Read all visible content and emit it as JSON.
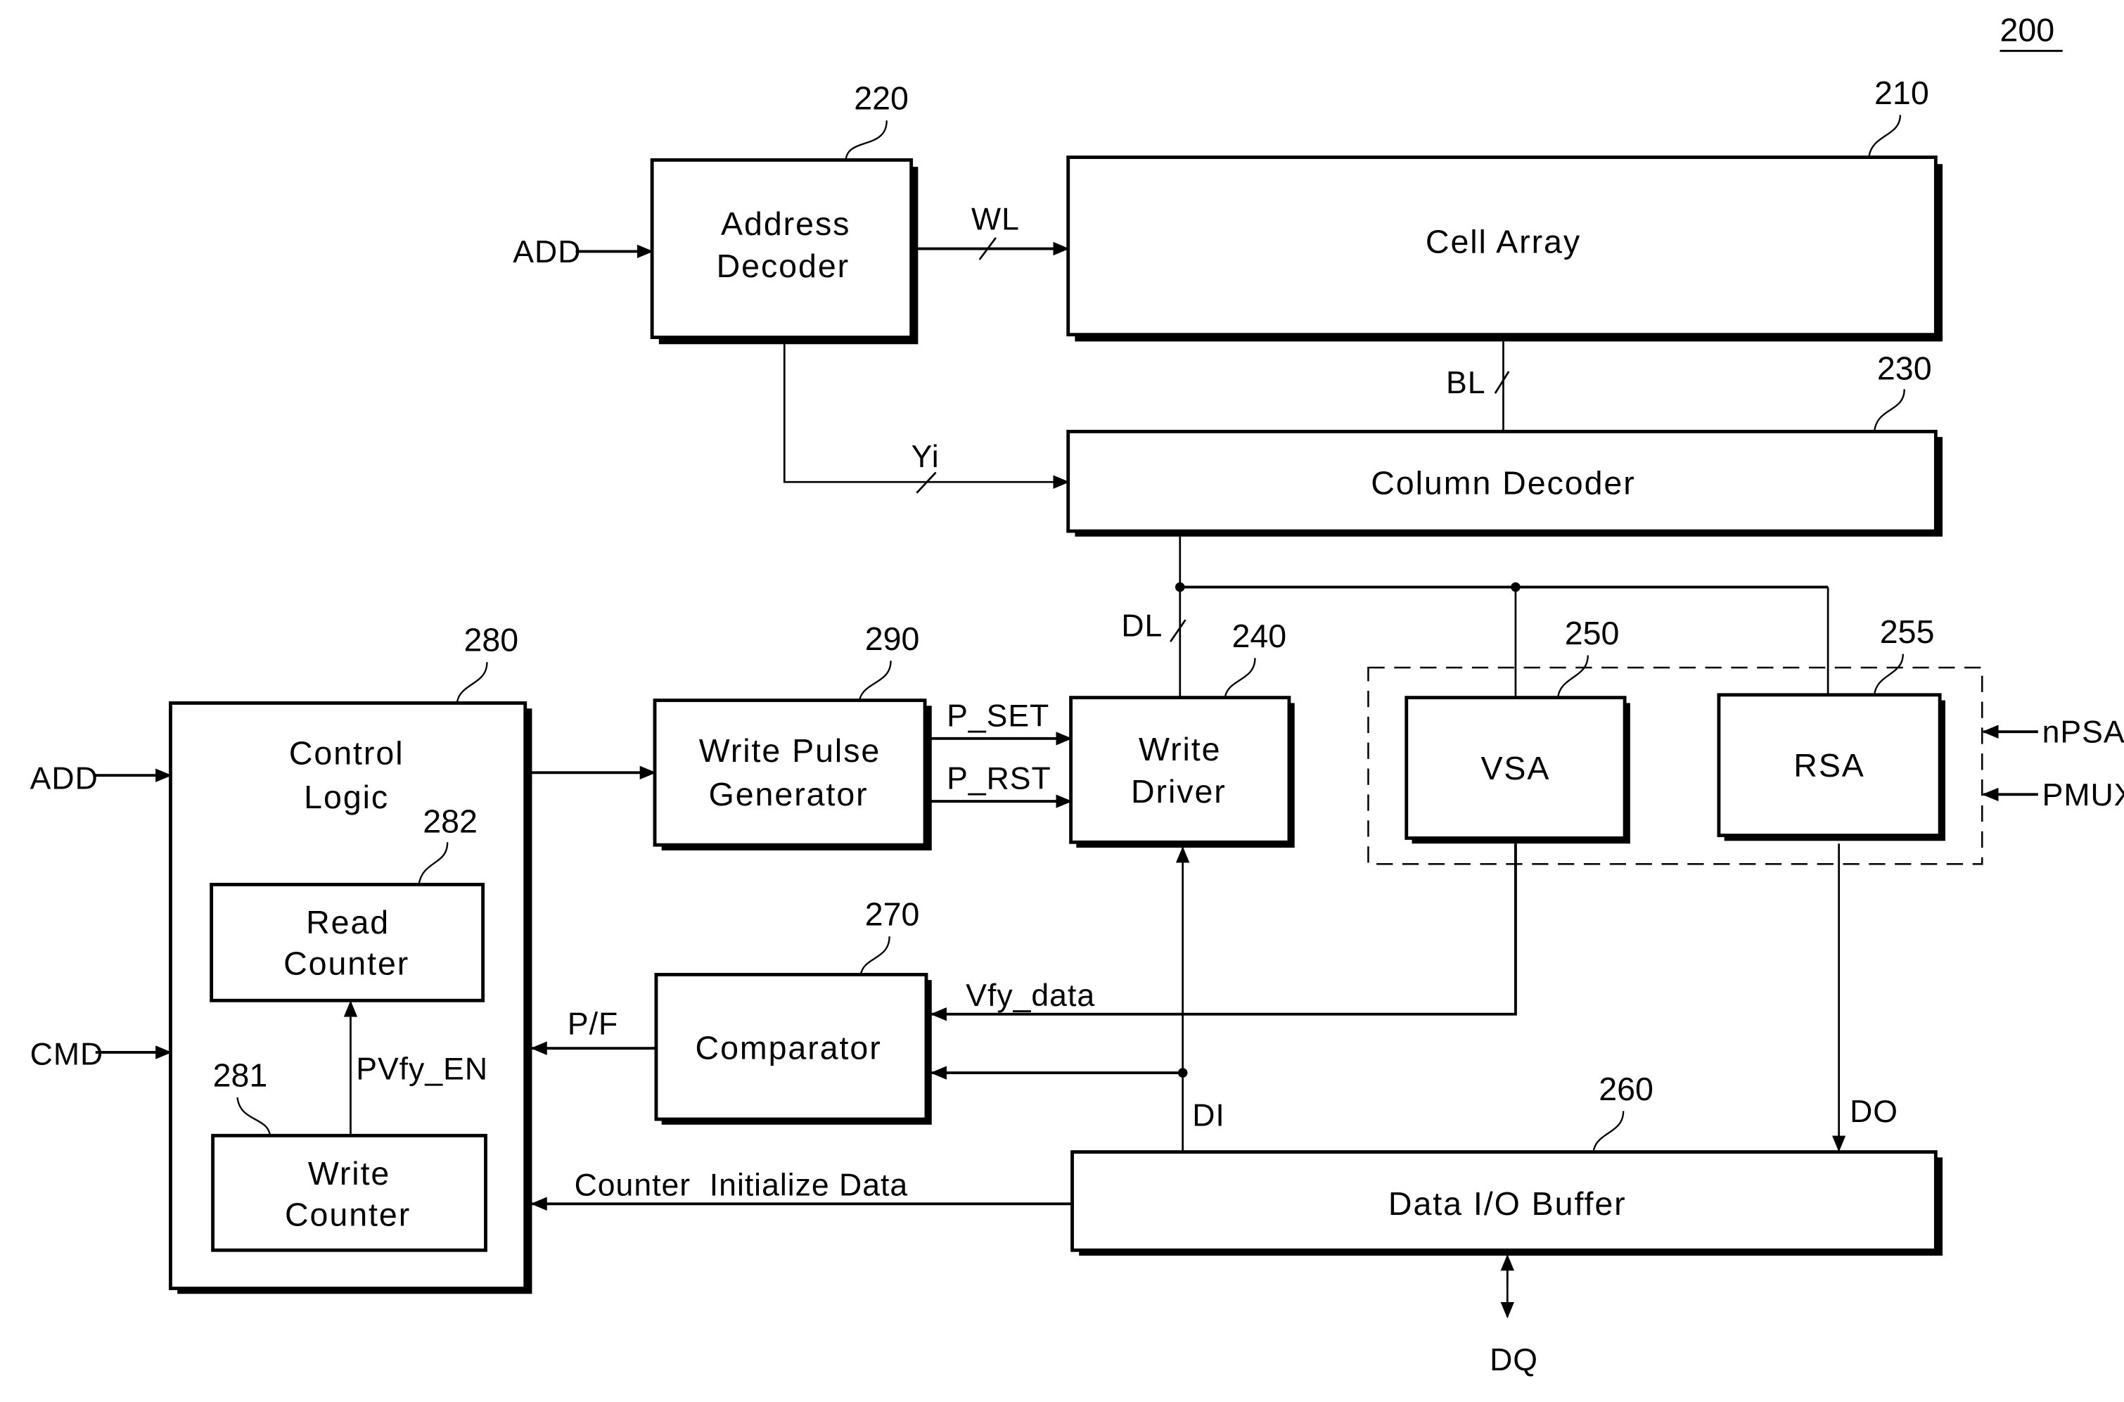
{
  "figure": {
    "ref": "200",
    "blocks": {
      "cell_array": {
        "ref": "210",
        "label": [
          "Cell Array"
        ]
      },
      "address_decoder": {
        "ref": "220",
        "label": [
          "Address",
          "Decoder"
        ]
      },
      "column_decoder": {
        "ref": "230",
        "label": [
          "Column Decoder"
        ]
      },
      "write_driver": {
        "ref": "240",
        "label": [
          "Write",
          "Driver"
        ]
      },
      "vsa": {
        "ref": "250",
        "label": [
          "VSA"
        ]
      },
      "rsa": {
        "ref": "255",
        "label": [
          "RSA"
        ]
      },
      "data_io_buffer": {
        "ref": "260",
        "label": [
          "Data I/O Buffer"
        ]
      },
      "comparator": {
        "ref": "270",
        "label": [
          "Comparator"
        ]
      },
      "control_logic": {
        "ref": "280",
        "label": [
          "Control",
          "Logic"
        ]
      },
      "write_counter": {
        "ref": "281",
        "label": [
          "Write",
          "Counter"
        ]
      },
      "read_counter": {
        "ref": "282",
        "label": [
          "Read",
          "Counter"
        ]
      },
      "write_pulse_generator": {
        "ref": "290",
        "label": [
          "Write Pulse",
          "Generator"
        ]
      }
    },
    "signals": {
      "add_top": "ADD",
      "wl": "WL",
      "bl": "BL",
      "yi": "Yi",
      "dl": "DL",
      "add_left": "ADD",
      "cmd": "CMD",
      "p_set": "P_SET",
      "p_rst": "P_RST",
      "npsa": "nPSA",
      "pmux": "PMUX",
      "vfy_data": "Vfy_data",
      "pf": "P/F",
      "pvfy_en": "PVfy_EN",
      "di": "DI",
      "do": "DO",
      "counter_init": "Counter  Initialize Data",
      "dq": "DQ"
    }
  }
}
